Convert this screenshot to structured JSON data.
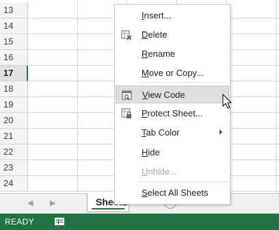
{
  "rows": [
    {
      "num": "13"
    },
    {
      "num": "14"
    },
    {
      "num": "15"
    },
    {
      "num": "16"
    },
    {
      "num": "17",
      "selected": true
    },
    {
      "num": "18"
    },
    {
      "num": "19"
    },
    {
      "num": "20"
    },
    {
      "num": "21"
    },
    {
      "num": "22"
    },
    {
      "num": "23"
    },
    {
      "num": "24"
    }
  ],
  "sheet_tab": {
    "label": "Sheet1"
  },
  "status": {
    "ready": "READY"
  },
  "context_menu": {
    "items": [
      {
        "key": "I",
        "rest": "nsert...",
        "name": "insert",
        "enabled": true
      },
      {
        "key": "D",
        "rest": "elete",
        "name": "delete",
        "enabled": true,
        "icon": "delete-sheet-icon"
      },
      {
        "key": "R",
        "rest": "ename",
        "name": "rename",
        "enabled": true
      },
      {
        "key": "M",
        "rest": "ove or Copy...",
        "name": "move-or-copy",
        "enabled": true
      },
      {
        "key": "V",
        "rest": "iew Code",
        "name": "view-code",
        "enabled": true,
        "icon": "view-code-icon",
        "hover": true
      },
      {
        "key": "P",
        "rest": "rotect Sheet...",
        "name": "protect-sheet",
        "enabled": true,
        "icon": "protect-sheet-icon"
      },
      {
        "key": "T",
        "rest": "ab Color",
        "name": "tab-color",
        "enabled": true,
        "submenu": true
      },
      {
        "key": "H",
        "rest": "ide",
        "name": "hide",
        "enabled": true
      },
      {
        "key": "U",
        "rest": "nhide...",
        "name": "unhide",
        "enabled": false
      },
      {
        "key": "S",
        "rest": "elect All Sheets",
        "name": "select-all-sheets",
        "enabled": true
      }
    ]
  }
}
